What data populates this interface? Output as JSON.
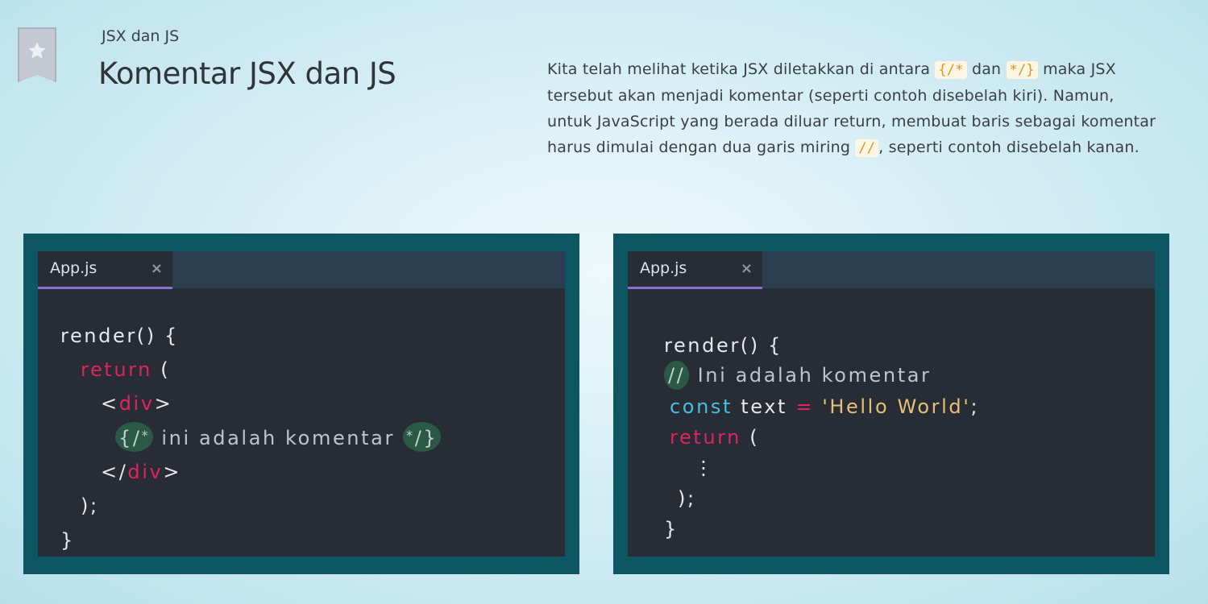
{
  "header": {
    "section_label": "JSX dan JS",
    "title": "Komentar JSX dan JS"
  },
  "description": {
    "part1": "Kita telah melihat ketika JSX diletakkan di antara ",
    "code1": "{/*",
    "part2": " dan ",
    "code2": "*/}",
    "part3": " maka JSX tersebut akan menjadi komentar (seperti contoh disebelah kiri). Namun, untuk JavaScript yang berada diluar return, membuat baris sebagai komentar harus dimulai dengan dua garis miring ",
    "code3": "//",
    "part4": ", seperti contoh disebelah kanan."
  },
  "colors": {
    "panel_bg": "#0f5663",
    "editor_bg": "#282c34",
    "keyword": "#e0245e",
    "const": "#45c0e6",
    "string": "#e5c07b",
    "comment_highlight": "#2a5a45",
    "tab_underline": "#8a6fd6"
  },
  "left_editor": {
    "tab_name": "App.js",
    "close_glyph": "×",
    "lines": {
      "l1": "render() {",
      "l2_kw": "return",
      "l2_rest": " (",
      "l3_open": "<",
      "l3_tag": "div",
      "l3_close": ">",
      "l4_open_brace": "{/",
      "l4_open_star": "*",
      "l4_text": " ini adalah komentar ",
      "l4_close_star": "*",
      "l4_close_brace": "/}",
      "l5_open": "</",
      "l5_tag": "div",
      "l5_close": ">",
      "l6": ");",
      "l7": "}"
    }
  },
  "right_editor": {
    "tab_name": "App.js",
    "close_glyph": "×",
    "lines": {
      "l1": "render() {",
      "l2_slashes": "//",
      "l2_text": " Ini adalah komentar",
      "l3_kw": "const",
      "l3_name": " text ",
      "l3_eq": "=",
      "l3_str": " 'Hello World'",
      "l3_semi": ";",
      "l4_kw": "return",
      "l4_rest": " (",
      "l5": "⋮",
      "l6": ");",
      "l7": "}"
    }
  }
}
